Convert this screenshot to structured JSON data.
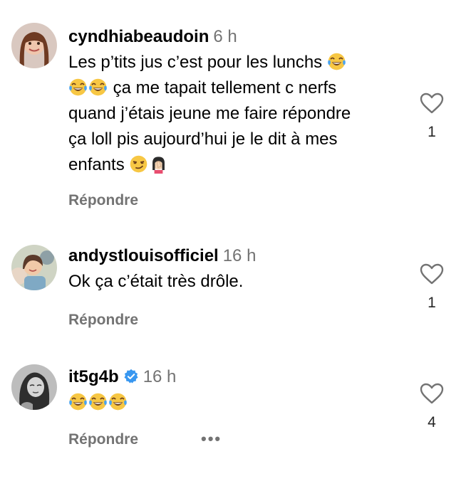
{
  "comments": [
    {
      "username": "cyndhiabeaudoin",
      "time": "6 h",
      "text_1": "Les p’tits jus c’est pour les lunchs ",
      "text_2": " ça me tapait tellement c nerfs",
      "text_3": "quand j’étais jeune me faire répondre",
      "text_4": "ça loll pis aujourd’hui je le dit à mes",
      "text_5": "enfants ",
      "reply_label": "Répondre",
      "likes": "1"
    },
    {
      "username": "andystlouisofficiel",
      "time": "16 h",
      "text_1": "Ok ça c’était très drôle.",
      "reply_label": "Répondre",
      "likes": "1"
    },
    {
      "username": "it5g4b",
      "time": "16 h",
      "verified": true,
      "reply_label": "Répondre",
      "likes": "4",
      "more_label": "•••"
    }
  ],
  "colors": {
    "secondary_text": "#737373",
    "verified_blue": "#3897f0"
  }
}
